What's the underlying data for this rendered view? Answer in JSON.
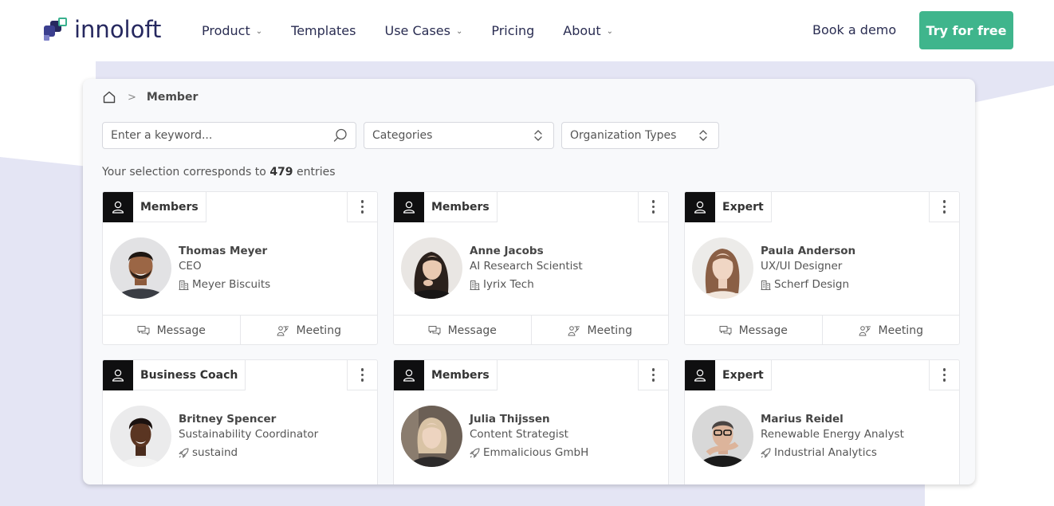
{
  "nav": {
    "logo_text": "innoloft",
    "items": [
      {
        "label": "Product",
        "has_dropdown": true
      },
      {
        "label": "Templates",
        "has_dropdown": false
      },
      {
        "label": "Use Cases",
        "has_dropdown": true
      },
      {
        "label": "Pricing",
        "has_dropdown": false
      },
      {
        "label": "About",
        "has_dropdown": true
      }
    ],
    "book_demo": "Book a demo",
    "try_free": "Try for free"
  },
  "breadcrumb": {
    "current": "Member",
    "icon": "home-icon",
    "separator": ">"
  },
  "filters": {
    "search_placeholder": "Enter a keyword...",
    "categories": "Categories",
    "org_types": "Organization Types"
  },
  "selection": {
    "prefix": "Your selection corresponds to",
    "count": "479",
    "suffix": "entries"
  },
  "cards": [
    {
      "role": "Members",
      "name": "Thomas Meyer",
      "title": "CEO",
      "org": "Meyer Biscuits",
      "org_icon": "building-icon",
      "message": "Message",
      "meeting": "Meeting"
    },
    {
      "role": "Members",
      "name": "Anne Jacobs",
      "title": "AI Research Scientist",
      "org": "Iyrix Tech",
      "org_icon": "building-icon",
      "message": "Message",
      "meeting": "Meeting"
    },
    {
      "role": "Expert",
      "name": "Paula Anderson",
      "title": "UX/UI Designer",
      "org": "Scherf Design",
      "org_icon": "building-icon",
      "message": "Message",
      "meeting": "Meeting"
    },
    {
      "role": "Business Coach",
      "name": "Britney Spencer",
      "title": "Sustainability Coordinator",
      "org": "sustaind",
      "org_icon": "rocket-icon"
    },
    {
      "role": "Members",
      "name": "Julia Thijssen",
      "title": "Content Strategist",
      "org": "Emmalicious GmbH",
      "org_icon": "rocket-icon"
    },
    {
      "role": "Expert",
      "name": "Marius Reidel",
      "title": "Renewable Energy Analyst",
      "org": "Industrial Analytics",
      "org_icon": "rocket-icon"
    }
  ],
  "colors": {
    "brand_navy": "#26285f",
    "brand_green": "#3fb58c",
    "background_band": "#e4e5f4"
  }
}
